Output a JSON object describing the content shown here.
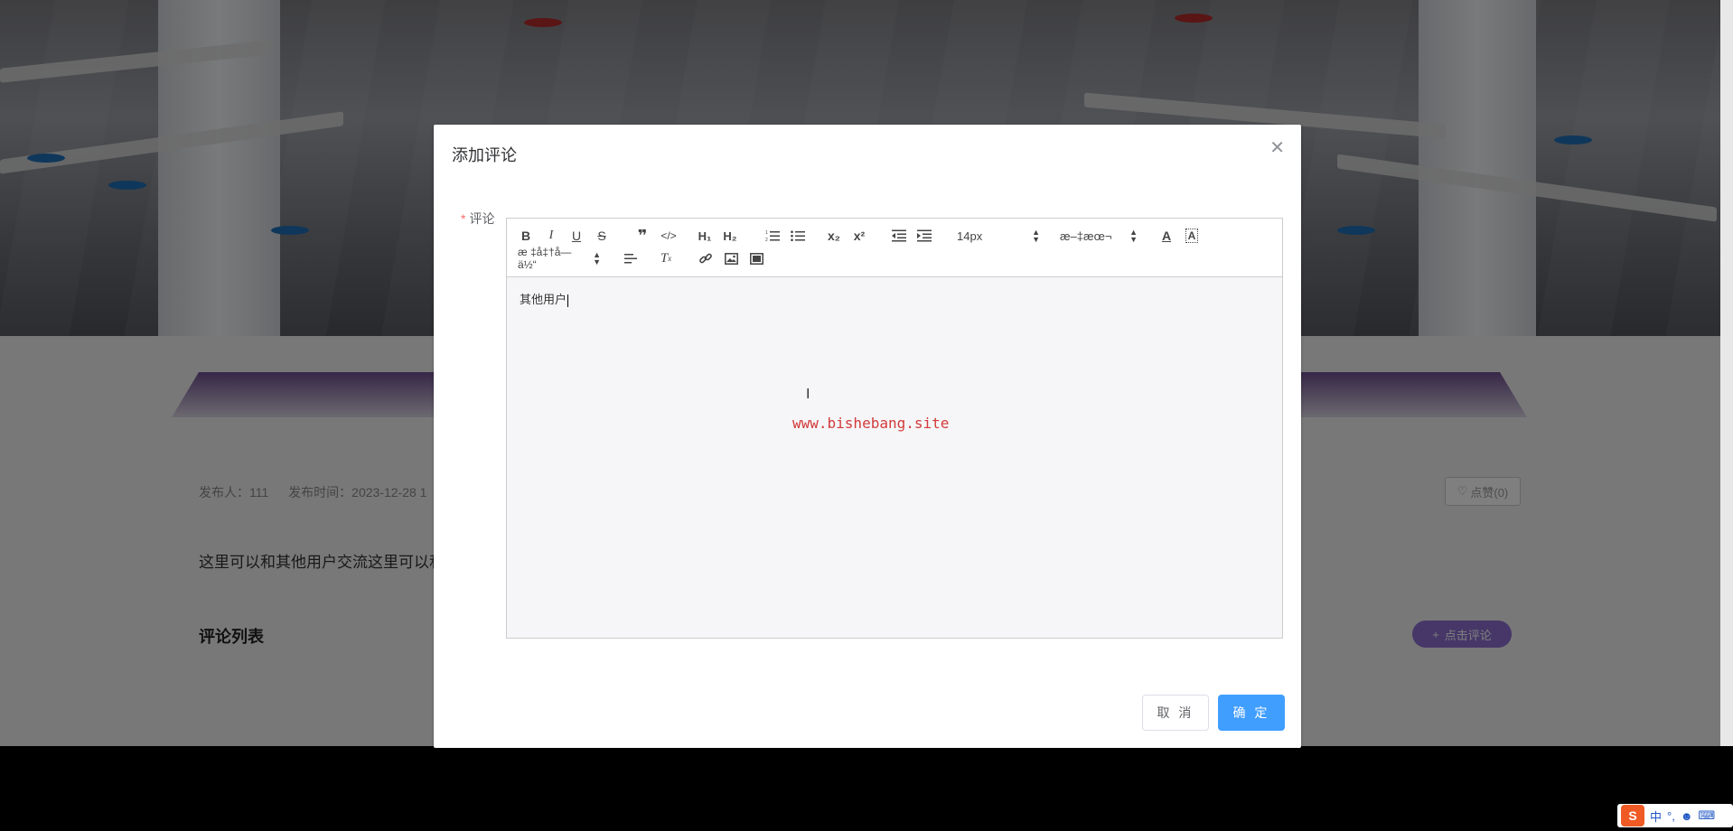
{
  "page": {
    "meta": {
      "publisher": "发布人：111",
      "publish_time": "发布时间：2023-12-28 1"
    },
    "like_button": "点赞(0)",
    "post_text": "这里可以和其他用户交流这里可以和其",
    "comment_list_title": "评论列表",
    "add_comment_button": "点击评论"
  },
  "dialog": {
    "title": "添加评论",
    "field_label": "评论",
    "required_mark": "*",
    "toolbar": {
      "font_size": "14px",
      "font_family": "æ–‡æœ¬",
      "header_select": "æ ‡å‡†å­—ä½“",
      "icons": [
        "bold-icon",
        "italic-icon",
        "underline-icon",
        "strikethrough-icon",
        "blockquote-icon",
        "code-block-icon",
        "h1-icon",
        "h2-icon",
        "ordered-list-icon",
        "bullet-list-icon",
        "subscript-icon",
        "superscript-icon",
        "outdent-icon",
        "indent-icon",
        "font-color-icon",
        "background-color-icon",
        "align-icon",
        "clear-format-icon",
        "link-icon",
        "image-icon",
        "video-icon"
      ]
    },
    "content_text": "其他用户",
    "watermark": "www.bishebang.site",
    "cancel_button": "取 消",
    "ok_button": "确 定"
  },
  "ime": {
    "mode": "中",
    "punct": "°,"
  },
  "colors": {
    "primary": "#409eff",
    "danger": "#f56c6c",
    "accent": "#8c6fd0"
  }
}
